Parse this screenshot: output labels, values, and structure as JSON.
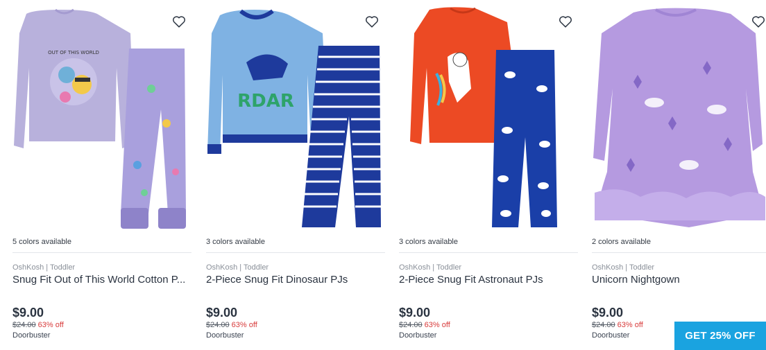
{
  "products": [
    {
      "colors_text": "5 colors available",
      "brand": "OshKosh | Toddler",
      "title": "Snug Fit Out of This World Cotton P...",
      "price": "$9.00",
      "original_price": "$24.00",
      "discount": "63% off",
      "badge": "Doorbuster",
      "image": "purple-space-pajamas-image",
      "image_print": "OUT OF THIS WORLD",
      "main_color": "#b8b1dc",
      "accent_color": "#8e83c9"
    },
    {
      "colors_text": "3 colors available",
      "brand": "OshKosh | Toddler",
      "title": "2-Piece Snug Fit Dinosaur PJs",
      "price": "$9.00",
      "original_price": "$24.00",
      "discount": "63% off",
      "badge": "Doorbuster",
      "image": "blue-dinosaur-pajamas-image",
      "image_print": "RDAR",
      "main_color": "#7fb2e3",
      "accent_color": "#1e3a9c"
    },
    {
      "colors_text": "3 colors available",
      "brand": "OshKosh | Toddler",
      "title": "2-Piece Snug Fit Astronaut PJs",
      "price": "$9.00",
      "original_price": "$24.00",
      "discount": "63% off",
      "badge": "Doorbuster",
      "image": "orange-astronaut-pajamas-image",
      "main_color": "#ec4a24",
      "accent_color": "#1a3fa8"
    },
    {
      "colors_text": "2 colors available",
      "brand": "OshKosh | Toddler",
      "title": "Unicorn Nightgown",
      "price": "$9.00",
      "original_price": "$24.00",
      "discount": "63% off",
      "badge": "Doorbuster",
      "image": "purple-unicorn-nightgown-image",
      "main_color": "#b59ae0",
      "accent_color": "#8468c6"
    }
  ],
  "promo_button": "GET 25% OFF",
  "colors": {
    "discount_red": "#d83a3a",
    "promo_blue": "#1aa3e0",
    "text_dark": "#2a3340",
    "text_muted": "#8a9099"
  },
  "icons": {
    "favorite": "heart-outline-icon"
  }
}
